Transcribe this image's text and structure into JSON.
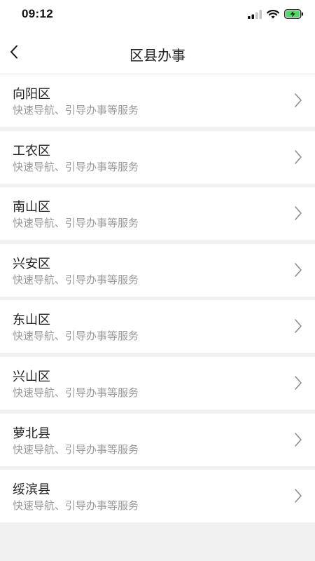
{
  "status_bar": {
    "time": "09:12",
    "icons": [
      "signal-icon",
      "wifi-icon",
      "battery-charging-icon"
    ],
    "battery_color": "#4cd964"
  },
  "nav": {
    "back_icon": "chevron-left-icon",
    "title": "区县办事"
  },
  "districts": [
    {
      "name": "向阳区",
      "desc": "快速导航、引导办事等服务"
    },
    {
      "name": "工农区",
      "desc": "快速导航、引导办事等服务"
    },
    {
      "name": "南山区",
      "desc": "快速导航、引导办事等服务"
    },
    {
      "name": "兴安区",
      "desc": "快速导航、引导办事等服务"
    },
    {
      "name": "东山区",
      "desc": "快速导航、引导办事等服务"
    },
    {
      "name": "兴山区",
      "desc": "快速导航、引导办事等服务"
    },
    {
      "name": "萝北县",
      "desc": "快速导航、引导办事等服务"
    },
    {
      "name": "绥滨县",
      "desc": "快速导航、引导办事等服务"
    }
  ]
}
